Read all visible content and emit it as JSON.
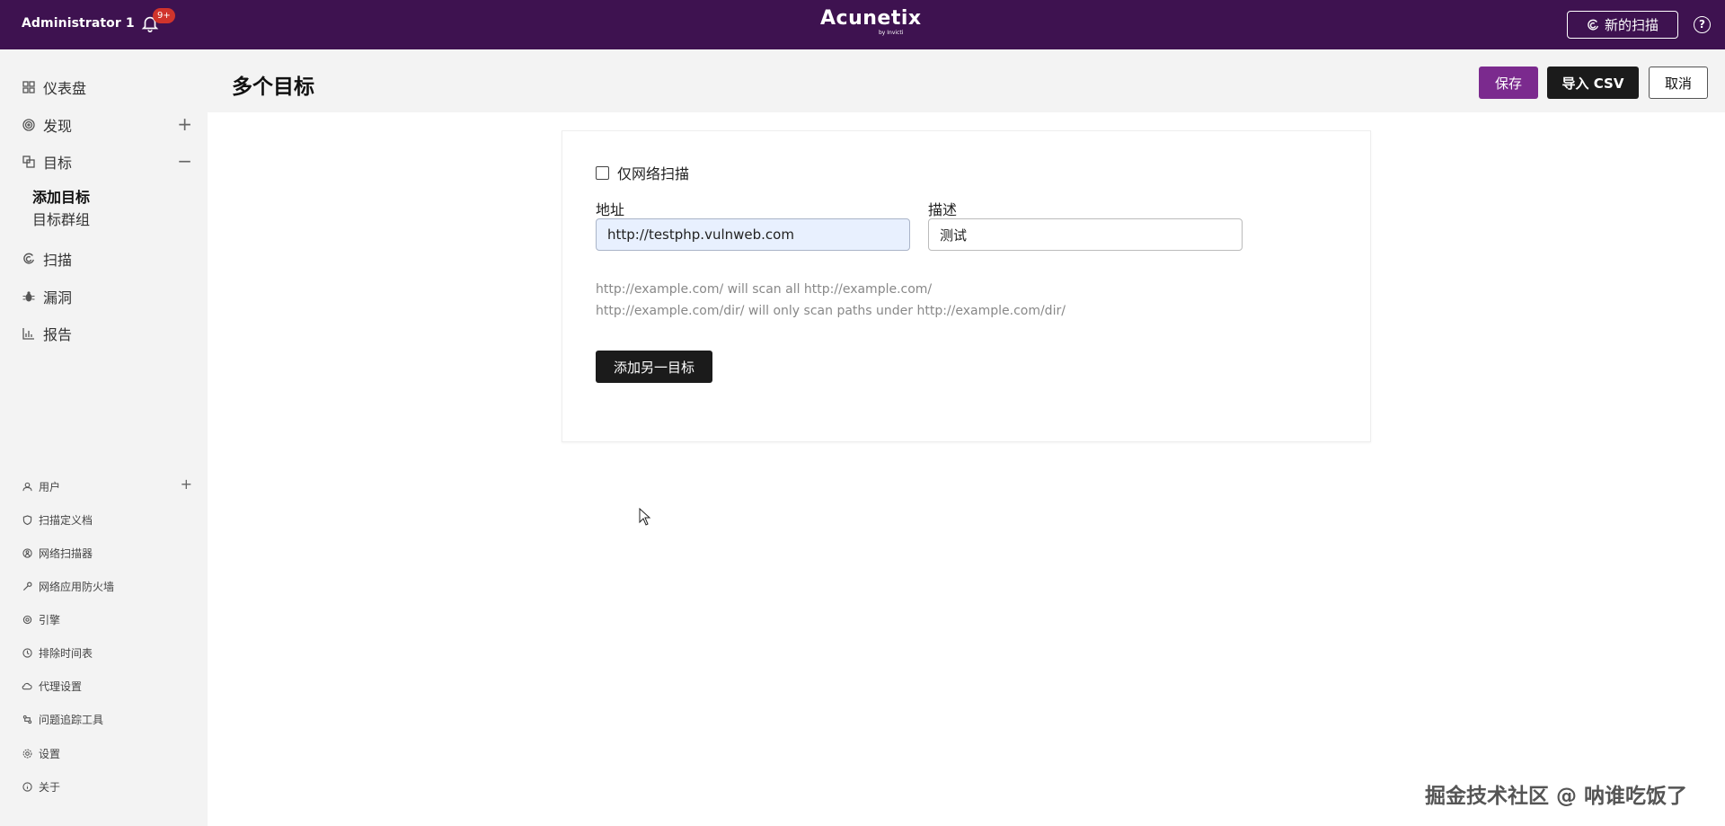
{
  "topbar": {
    "user": "Administrator 1",
    "notif_badge": "9+",
    "brand": "Acunetix",
    "brand_sub": "by Invicti",
    "new_scan": "新的扫描",
    "help": "?"
  },
  "sidebar": {
    "items": [
      {
        "label": "仪表盘",
        "icon": "dashboard-icon"
      },
      {
        "label": "发现",
        "icon": "target-icon",
        "trail": "+"
      },
      {
        "label": "目标",
        "icon": "targets-icon",
        "trail": "−"
      },
      {
        "label": "扫描",
        "icon": "scan-icon"
      },
      {
        "label": "漏洞",
        "icon": "bug-icon"
      },
      {
        "label": "报告",
        "icon": "chart-icon"
      }
    ],
    "sub_items": [
      "添加目标",
      "目标群组"
    ],
    "settings_items": [
      {
        "label": "用户",
        "trail": "+"
      },
      {
        "label": "扫描定义档"
      },
      {
        "label": "网络扫描器"
      },
      {
        "label": "网络应用防火墙"
      },
      {
        "label": "引擎"
      },
      {
        "label": "排除时间表"
      },
      {
        "label": "代理设置"
      },
      {
        "label": "问题追踪工具"
      },
      {
        "label": "设置"
      },
      {
        "label": "关于"
      }
    ]
  },
  "header": {
    "title": "多个目标",
    "save": "保存",
    "import_csv": "导入 CSV",
    "cancel": "取消"
  },
  "form": {
    "network_only_label": "仅网络扫描",
    "network_only_checked": false,
    "address_label": "地址",
    "address_value": "http://testphp.vulnweb.com",
    "desc_label": "描述",
    "desc_value": "测试",
    "hint1": "http://example.com/ will scan all http://example.com/",
    "hint2": "http://example.com/dir/ will only scan paths under http://example.com/dir/",
    "add_another": "添加另一目标"
  },
  "watermark": "掘金技术社区 @ 呐谁吃饭了"
}
